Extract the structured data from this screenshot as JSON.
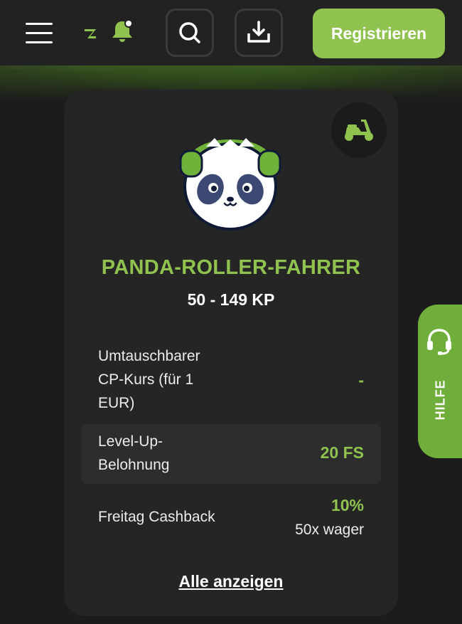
{
  "header": {
    "register_label": "Registrieren",
    "icons": [
      "menu-icon",
      "brand-logo",
      "bell-icon",
      "search-icon",
      "download-icon"
    ],
    "accent_color": "#8fc24f"
  },
  "card": {
    "badge_icon": "scooter-icon",
    "mascot": "panda-headphones",
    "level_title": "PANDA-ROLLER-FAHRER",
    "level_range": "50 - 149 KP",
    "rows": [
      {
        "label_lines": [
          "Umtauschbarer",
          "CP-Kurs (für 1",
          "EUR)"
        ],
        "value": "-"
      },
      {
        "label_lines": [
          "Level-Up-",
          "Belohnung"
        ],
        "value": "20 FS"
      },
      {
        "label_lines": [
          "Freitag Cashback"
        ],
        "value": "10%",
        "sub_value": "50x wager"
      }
    ],
    "show_all_label": "Alle anzeigen"
  },
  "help": {
    "label": "HILFE",
    "icon": "headset-icon"
  }
}
